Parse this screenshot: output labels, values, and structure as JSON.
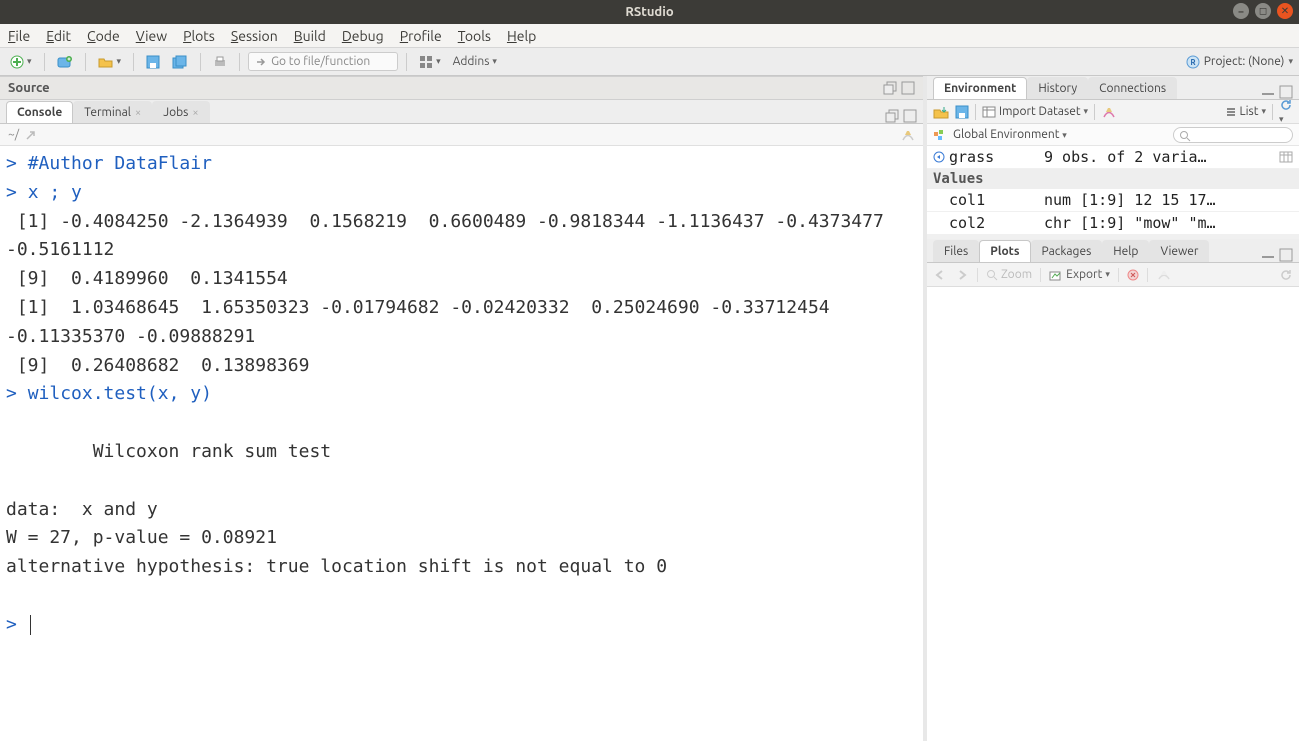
{
  "title": "RStudio",
  "menus": [
    "File",
    "Edit",
    "Code",
    "View",
    "Plots",
    "Session",
    "Build",
    "Debug",
    "Profile",
    "Tools",
    "Help"
  ],
  "toolbar": {
    "goto_placeholder": "Go to file/function",
    "addins": "Addins",
    "project_label": "Project: (None)"
  },
  "panes": {
    "source_label": "Source",
    "console_tabs": [
      "Console",
      "Terminal",
      "Jobs"
    ],
    "console_path": "~/",
    "env_tabs": [
      "Environment",
      "History",
      "Connections"
    ],
    "files_tabs": [
      "Files",
      "Plots",
      "Packages",
      "Help",
      "Viewer"
    ]
  },
  "env_toolbar": {
    "import": "Import Dataset",
    "list": "List",
    "scope": "Global Environment",
    "search_placeholder": ""
  },
  "env_data": {
    "object": {
      "name": "grass",
      "desc": "9 obs. of 2 varia…"
    },
    "values_label": "Values",
    "rows": [
      {
        "name": "col1",
        "desc": "num [1:9] 12 15 17…"
      },
      {
        "name": "col2",
        "desc": "chr [1:9] \"mow\" \"m…"
      }
    ]
  },
  "plots_toolbar": {
    "zoom": "Zoom",
    "export": "Export"
  },
  "console": {
    "lines": [
      {
        "t": "prompt",
        "text": "> "
      },
      {
        "t": "cmd",
        "text": "#Author DataFlair"
      },
      {
        "t": "nl"
      },
      {
        "t": "prompt",
        "text": "> "
      },
      {
        "t": "cmd",
        "text": "x ; y"
      },
      {
        "t": "nl"
      },
      {
        "t": "out",
        "text": " [1] -0.4084250 -2.1364939  0.1568219  0.6600489 -0.9818344 -1.1136437 -0.4373477 -0.5161112"
      },
      {
        "t": "nl"
      },
      {
        "t": "out",
        "text": " [9]  0.4189960  0.1341554"
      },
      {
        "t": "nl"
      },
      {
        "t": "out",
        "text": " [1]  1.03468645  1.65350323 -0.01794682 -0.02420332  0.25024690 -0.33712454 -0.11335370 -0.09888291"
      },
      {
        "t": "nl"
      },
      {
        "t": "out",
        "text": " [9]  0.26408682  0.13898369"
      },
      {
        "t": "nl"
      },
      {
        "t": "prompt",
        "text": "> "
      },
      {
        "t": "cmd",
        "text": "wilcox.test(x, y)"
      },
      {
        "t": "nl"
      },
      {
        "t": "out",
        "text": ""
      },
      {
        "t": "nl"
      },
      {
        "t": "out",
        "text": "        Wilcoxon rank sum test"
      },
      {
        "t": "nl"
      },
      {
        "t": "out",
        "text": ""
      },
      {
        "t": "nl"
      },
      {
        "t": "out",
        "text": "data:  x and y"
      },
      {
        "t": "nl"
      },
      {
        "t": "out",
        "text": "W = 27, p-value = 0.08921"
      },
      {
        "t": "nl"
      },
      {
        "t": "out",
        "text": "alternative hypothesis: true location shift is not equal to 0"
      },
      {
        "t": "nl"
      },
      {
        "t": "out",
        "text": ""
      },
      {
        "t": "nl"
      },
      {
        "t": "prompt",
        "text": "> "
      },
      {
        "t": "cursor"
      }
    ]
  }
}
